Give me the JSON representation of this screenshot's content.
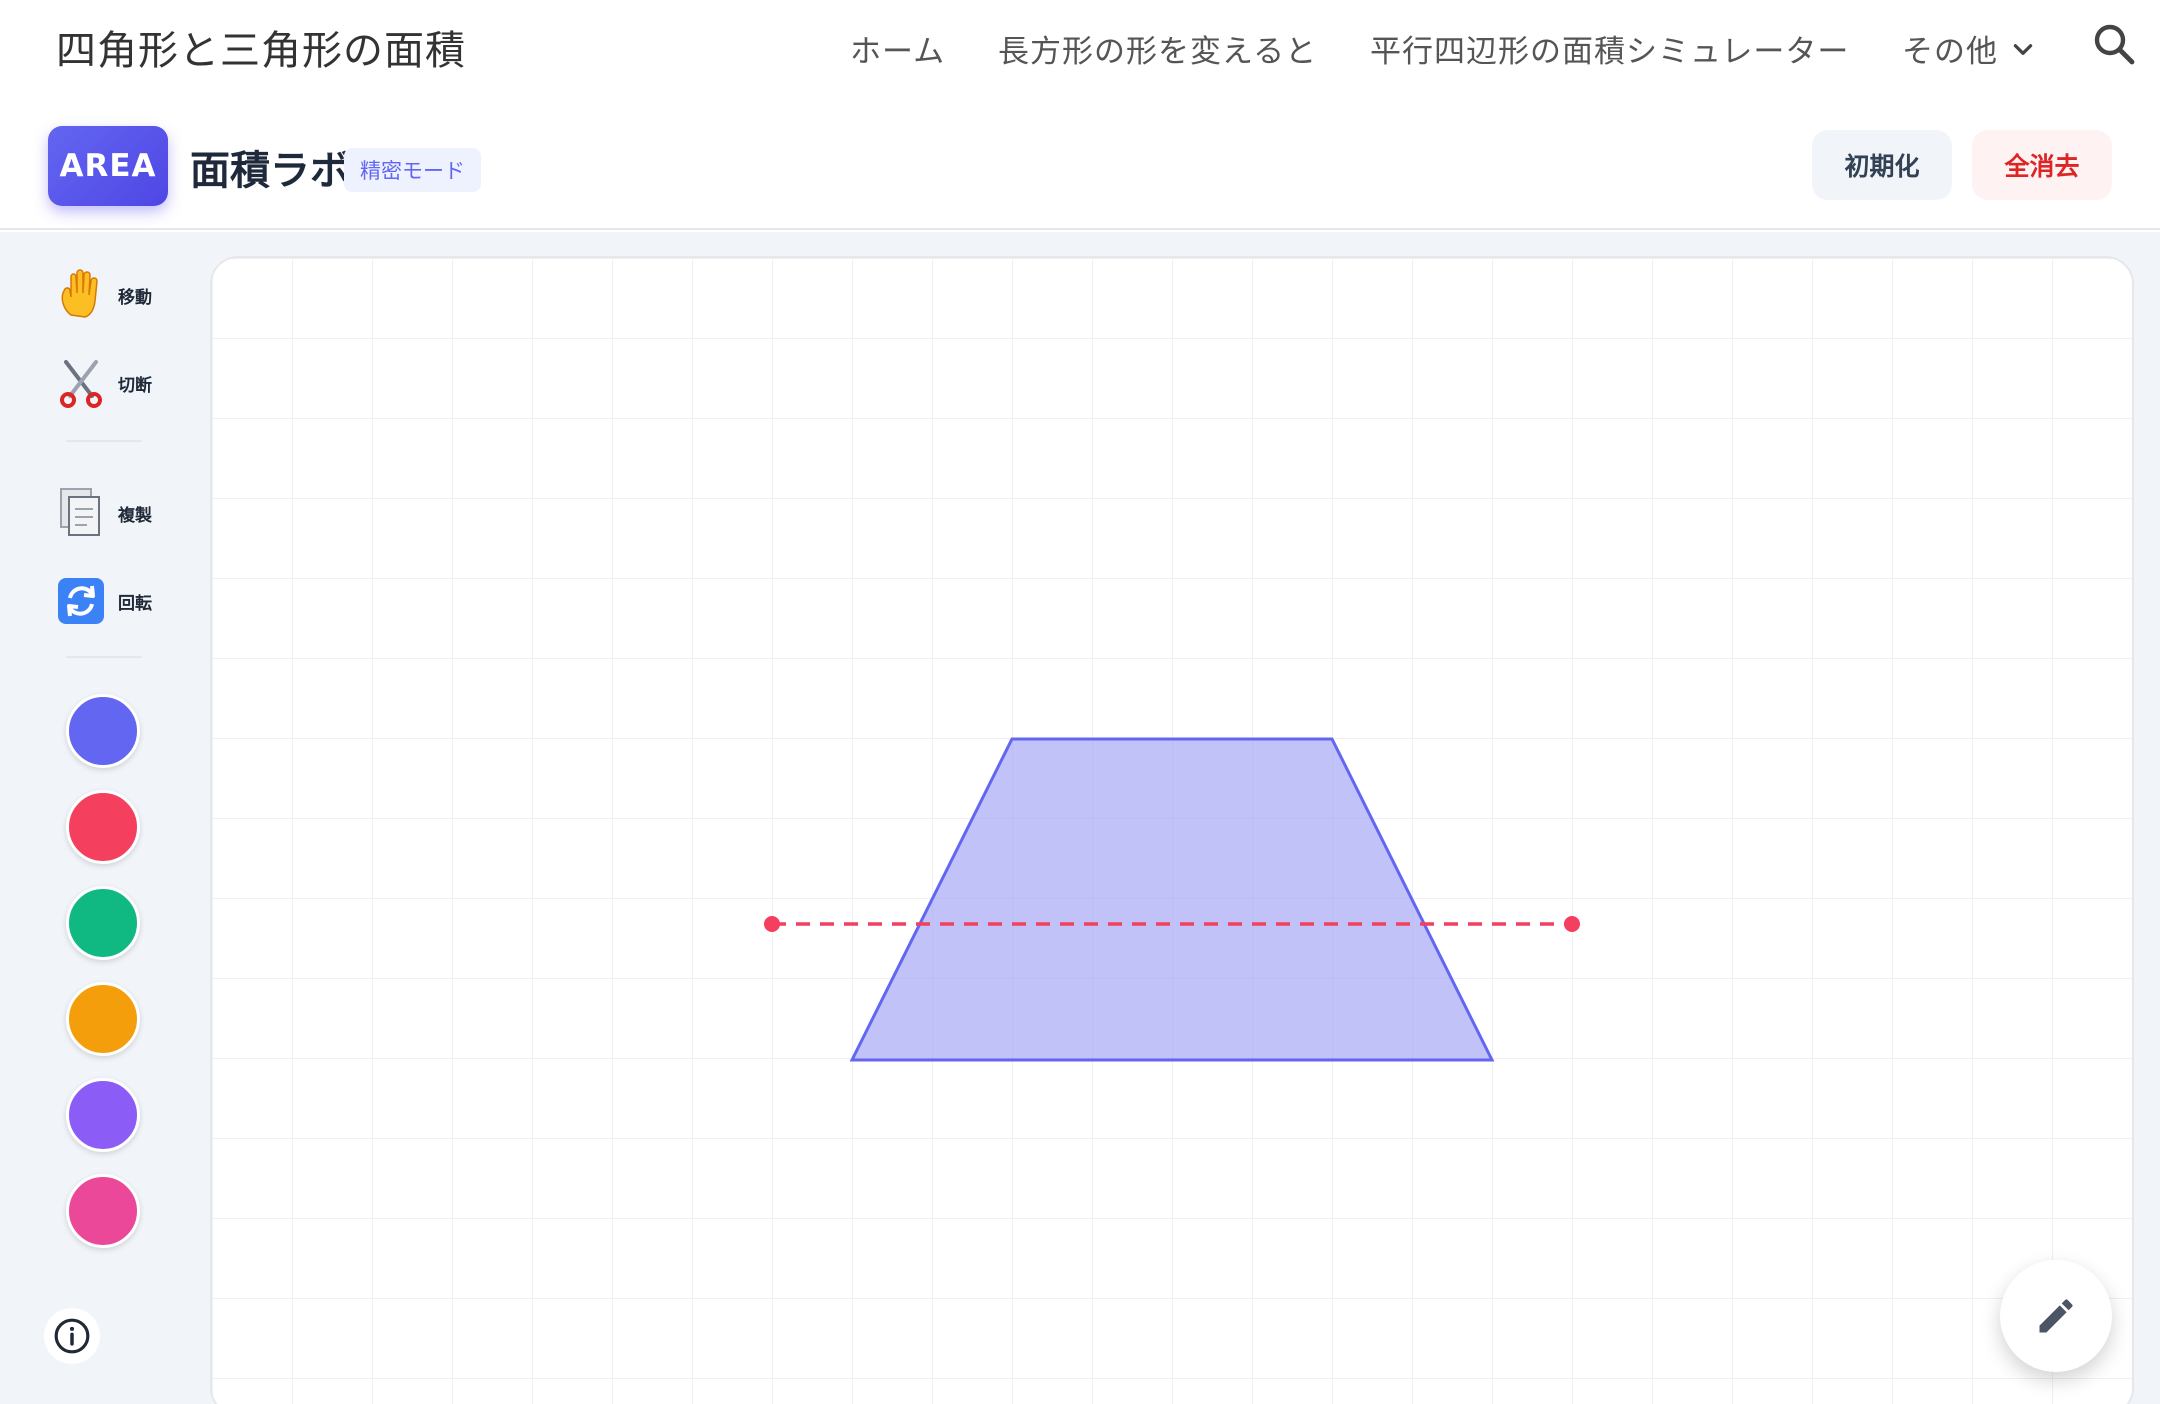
{
  "site": {
    "title": "四角形と三角形の面積",
    "nav": {
      "home": "ホーム",
      "rect_change": "長方形の形を変えると",
      "parallelogram_sim": "平行四辺形の面積シミュレーター",
      "more": "その他"
    }
  },
  "app": {
    "logo": "AREA",
    "title": "面積ラボ",
    "mode_badge": "精密モード",
    "reset_label": "初期化",
    "clear_label": "全消去"
  },
  "tools": {
    "move": "移動",
    "cut": "切断",
    "duplicate": "複製",
    "rotate": "回転"
  },
  "colors": {
    "palette": [
      "#6366f1",
      "#f43f5e",
      "#10b981",
      "#f59e0b",
      "#8b5cf6",
      "#ec4899"
    ],
    "shape_fill": "#a5a8f5",
    "shape_stroke": "#6366f1",
    "cut_line": "#f43f5e"
  },
  "icons": {
    "move": "hand-icon",
    "cut": "scissors-icon",
    "duplicate": "copy-icon",
    "rotate": "rotate-icon",
    "info": "info-icon",
    "fab": "pencil-icon",
    "search": "search-icon"
  }
}
